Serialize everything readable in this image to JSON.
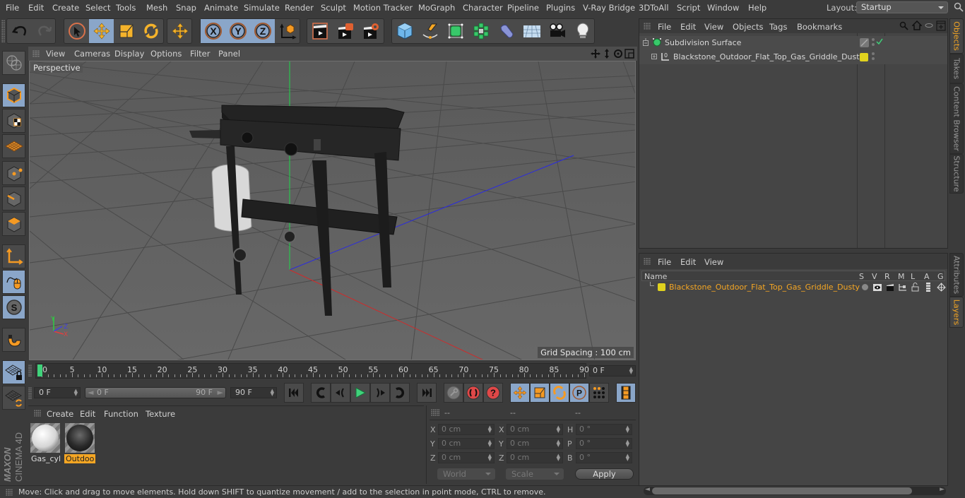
{
  "menubar": {
    "items": [
      "File",
      "Edit",
      "Create",
      "Select",
      "Tools",
      "Mesh",
      "Snap",
      "Animate",
      "Simulate",
      "Render",
      "Sculpt",
      "Motion Tracker",
      "MoGraph",
      "Character",
      "Pipeline",
      "Plugins",
      "V-Ray Bridge",
      "3DToAll",
      "Script",
      "Window",
      "Help"
    ],
    "layout_label": "Layout:",
    "layout_value": "Startup"
  },
  "toolbar": {
    "groups": [
      {
        "name": "history",
        "buttons": [
          "undo",
          "redo"
        ]
      },
      {
        "name": "tools",
        "buttons": [
          "live-selection",
          "move",
          "scale",
          "rotate",
          "last-tool"
        ]
      },
      {
        "name": "axes",
        "buttons": [
          "x-axis-lock",
          "y-axis-lock",
          "z-axis-lock",
          "coordinate-system"
        ]
      },
      {
        "name": "render",
        "buttons": [
          "render-view",
          "render-to-picture-viewer",
          "edit-render-settings"
        ]
      },
      {
        "name": "objects",
        "buttons": [
          "cube",
          "pen",
          "subdivision-surface",
          "cloner",
          "deformer",
          "floor",
          "camera",
          "light"
        ]
      }
    ],
    "axis_labels": [
      "X",
      "Y",
      "Z"
    ]
  },
  "viewport": {
    "menu": [
      "View",
      "Cameras",
      "Display",
      "Options",
      "Filter",
      "Panel"
    ],
    "camera_label": "Perspective",
    "grid_spacing": "Grid Spacing : 100 cm",
    "axis_labels": {
      "x": "X",
      "y": "Y",
      "z": "Z"
    }
  },
  "left_tools": [
    "make-editable",
    "model",
    "texture",
    "workplane",
    "points",
    "edges",
    "polygons",
    "locked-axis",
    "tweak",
    "solo",
    "snap",
    "workplane-lock",
    "workplane-align"
  ],
  "brand": {
    "maxon": "MAXON",
    "product": "CINEMA 4D"
  },
  "timeline": {
    "ticks": [
      "0",
      "5",
      "10",
      "15",
      "20",
      "25",
      "30",
      "35",
      "40",
      "45",
      "50",
      "55",
      "60",
      "65",
      "70",
      "75",
      "80",
      "85",
      "90"
    ],
    "current_frame_right": "0 F",
    "start_frame": "0 F",
    "range_start": "0 F",
    "range_end": "90 F",
    "end_frame": "90 F",
    "playhead_frame": 0,
    "max_frame": 90
  },
  "materials": {
    "menu": [
      "Create",
      "Edit",
      "Function",
      "Texture"
    ],
    "items": [
      {
        "name": "Gas_cyli",
        "selected": false,
        "tone": "white"
      },
      {
        "name": "Outdoo",
        "selected": true,
        "tone": "dark"
      }
    ]
  },
  "coordinates": {
    "headers": [
      "--",
      "--",
      "--"
    ],
    "position": [
      {
        "axis": "X",
        "value": "0 cm"
      },
      {
        "axis": "Y",
        "value": "0 cm"
      },
      {
        "axis": "Z",
        "value": "0 cm"
      }
    ],
    "size": [
      {
        "axis": "X",
        "value": "0 cm"
      },
      {
        "axis": "Y",
        "value": "0 cm"
      },
      {
        "axis": "Z",
        "value": "0 cm"
      }
    ],
    "rotation": [
      {
        "axis": "H",
        "value": "0 °"
      },
      {
        "axis": "P",
        "value": "0 °"
      },
      {
        "axis": "B",
        "value": "0 °"
      }
    ],
    "mode_select": "World",
    "size_select": "Scale",
    "apply_label": "Apply"
  },
  "status": {
    "text": "Move: Click and drag to move elements. Hold down SHIFT to quantize movement / add to the selection in point mode, CTRL to remove."
  },
  "objects_panel": {
    "menu": [
      "File",
      "Edit",
      "View",
      "Objects",
      "Tags",
      "Bookmarks"
    ],
    "rows": [
      {
        "name": "Subdivision Surface",
        "expanded": true,
        "enabled": true
      },
      {
        "name": "Blackstone_Outdoor_Flat_Top_Gas_Griddle_Dusty",
        "expanded": false,
        "layer_color": "#e0d21e"
      }
    ]
  },
  "layers_panel": {
    "menu": [
      "File",
      "Edit",
      "View"
    ],
    "columns": [
      "Name",
      "S",
      "V",
      "R",
      "M",
      "L",
      "A",
      "G"
    ],
    "rows": [
      {
        "name": "Blackstone_Outdoor_Flat_Top_Gas_Griddle_Dusty",
        "color": "#e0d21e"
      }
    ]
  },
  "right_tabs_top": [
    {
      "label": "Objects",
      "active": true
    },
    {
      "label": "Takes",
      "active": false
    },
    {
      "label": "Content Browser",
      "active": false
    },
    {
      "label": "Structure",
      "active": false
    }
  ],
  "right_tabs_bottom": [
    {
      "label": "Attributes",
      "active": false
    },
    {
      "label": "Layers",
      "active": true
    }
  ],
  "colors": {
    "accent": "#f5a623",
    "selection_blue": "#8aa6c9",
    "layer_yellow": "#e0d21e",
    "playhead_green": "#3fd27a"
  }
}
